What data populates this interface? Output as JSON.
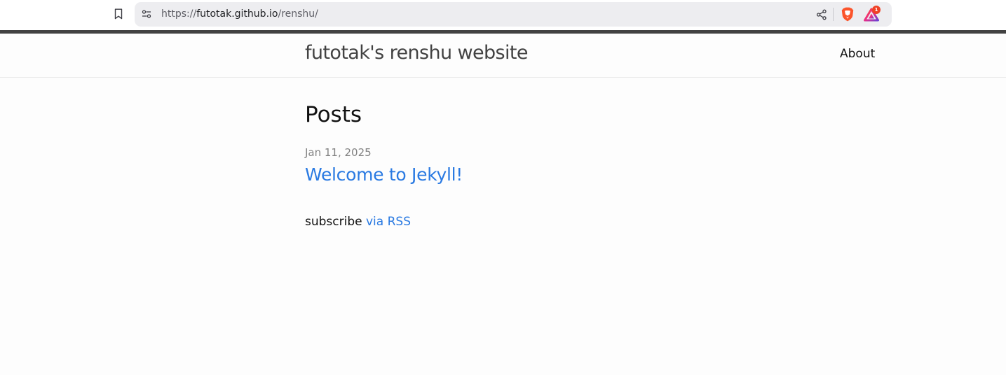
{
  "browser": {
    "url_scheme": "https://",
    "url_host": "futotak.github.io",
    "url_path": "/renshu/",
    "rewards_badge_count": "1",
    "icons": [
      "bookmark-icon",
      "site-info-icon",
      "share-icon",
      "brave-shield-icon",
      "brave-rewards-icon"
    ],
    "colors": {
      "url_bar_bg": "#ededf0",
      "shield": "#fb542b",
      "rewards_badge": "#ef4125"
    }
  },
  "site": {
    "title": "futotak's renshu website",
    "nav": {
      "about_label": "About"
    }
  },
  "main": {
    "heading": "Posts",
    "posts": [
      {
        "date": "Jan 11, 2025",
        "title": "Welcome to Jekyll!"
      }
    ],
    "subscribe_text": "subscribe",
    "rss_link_label": "via RSS"
  },
  "colors": {
    "header_border": "#424242",
    "link": "#2a7ae2",
    "meta_text": "#828282",
    "body_text": "#111111"
  }
}
